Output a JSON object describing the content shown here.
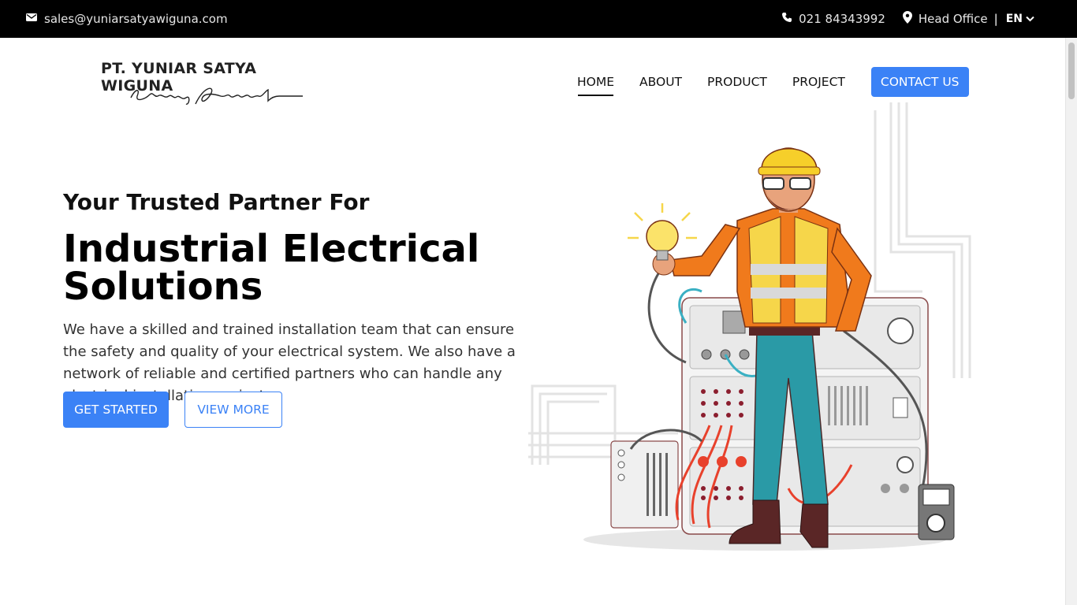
{
  "topbar": {
    "email": "sales@yuniarsatyawiguna.com",
    "phone": "021 84343992",
    "location": "Head Office",
    "language": "EN",
    "icons": [
      "mail-icon",
      "phone-icon",
      "location-pin-icon",
      "chevron-down-icon"
    ]
  },
  "logo": {
    "name": "PT. YUNIAR SATYA WIGUNA",
    "tagline": "Engineering Connected"
  },
  "nav": {
    "items": [
      "HOME",
      "ABOUT",
      "PRODUCT",
      "PROJECT"
    ],
    "active": "HOME",
    "contact_label": "CONTACT US"
  },
  "hero": {
    "subtitle": "Your Trusted Partner For",
    "title": "Industrial Electrical Solutions",
    "text": "We have a skilled and trained installation team that can ensure the safety and quality of your electrical system. We also have a network of reliable and certified partners who can handle any electrical installation project.",
    "primary_button": "GET STARTED",
    "secondary_button": "VIEW MORE"
  },
  "colors": {
    "accent": "#3b82f6",
    "topbar": "#000000"
  }
}
